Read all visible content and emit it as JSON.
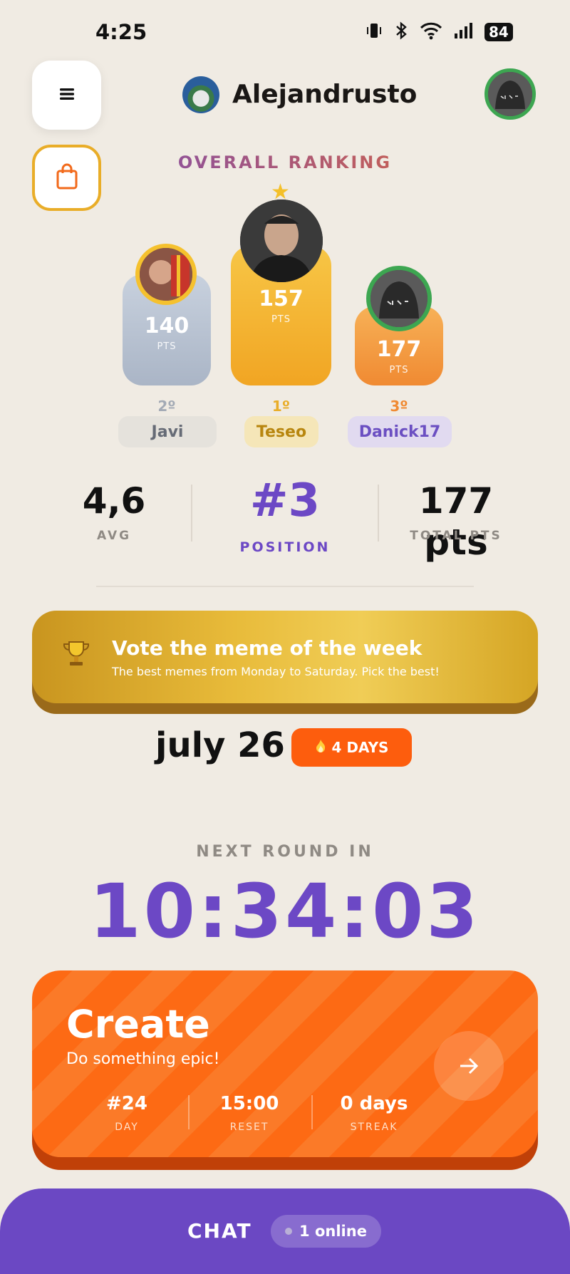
{
  "status_bar": {
    "time": "4:25",
    "battery": "84"
  },
  "header": {
    "app_title": "Alejandrusto"
  },
  "ranking": {
    "title": "OVERALL RANKING",
    "podium": [
      {
        "place": "2º",
        "name": "Javi",
        "points": "140",
        "pts_label": "PTS"
      },
      {
        "place": "1º",
        "name": "Teseo",
        "points": "157",
        "pts_label": "PTS"
      },
      {
        "place": "3º",
        "name": "Danick17",
        "points": "177",
        "pts_label": "PTS"
      }
    ]
  },
  "stats": {
    "avg_value": "4,6",
    "avg_label": "AVG",
    "position_value": "#3",
    "position_label": "POSITION",
    "total_value": "177 pts",
    "total_label": "TOTAL PTS"
  },
  "meme_banner": {
    "icon": "trophy-icon",
    "title": "Vote the meme of the week",
    "subtitle": "The best memes from Monday to Saturday. Pick the best!"
  },
  "event": {
    "date": "july 26",
    "days_badge": "4 DAYS"
  },
  "countdown": {
    "label": "NEXT ROUND IN",
    "time": "10:34:03"
  },
  "create_card": {
    "title": "Create",
    "subtitle": "Do something epic!",
    "stats": [
      {
        "value": "#24",
        "label": "DAY"
      },
      {
        "value": "15:00",
        "label": "RESET"
      },
      {
        "value": "0 days",
        "label": "STREAK"
      }
    ]
  },
  "chat": {
    "label": "CHAT",
    "online": "1 online"
  },
  "colors": {
    "accent": "#6c48c5",
    "orange": "#fd6a14",
    "gold": "#e9ad28",
    "background": "#f0ebe3"
  }
}
